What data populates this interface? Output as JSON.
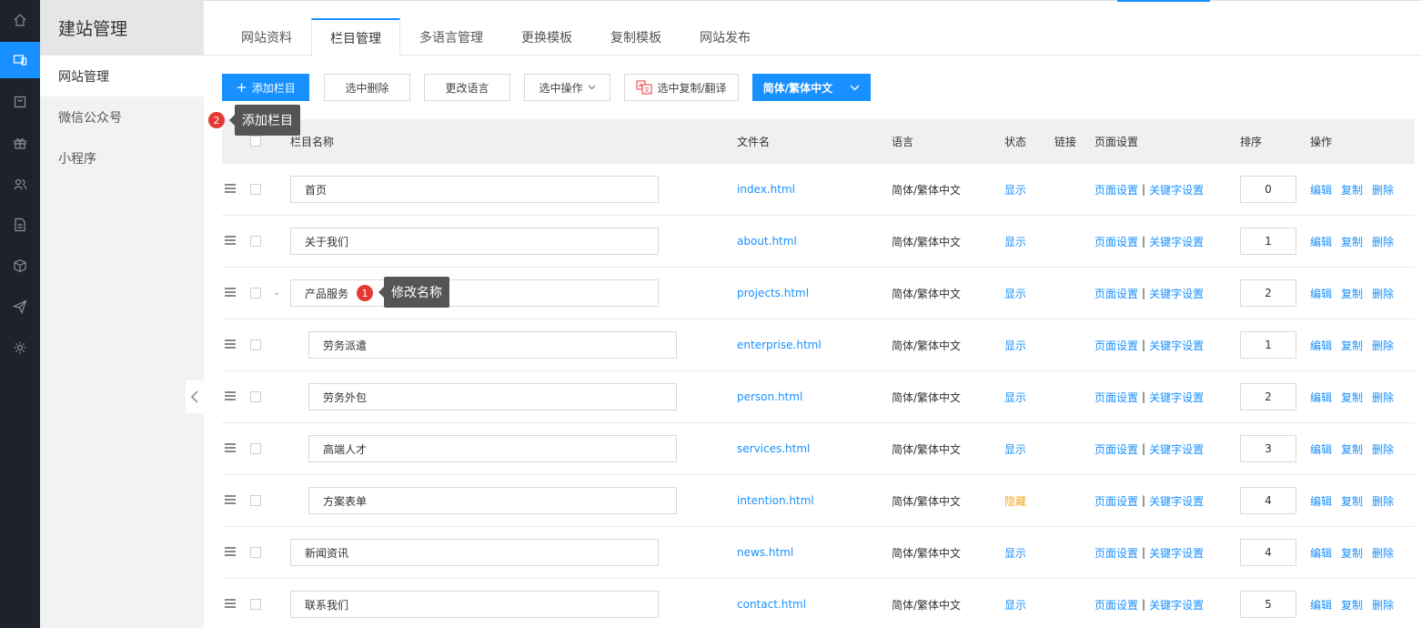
{
  "rail": {
    "items": [
      {
        "icon": "home-icon"
      },
      {
        "icon": "website-icon"
      },
      {
        "icon": "shop-icon"
      },
      {
        "icon": "gift-icon"
      },
      {
        "icon": "users-icon"
      },
      {
        "icon": "document-icon"
      },
      {
        "icon": "cube-icon"
      },
      {
        "icon": "send-icon"
      },
      {
        "icon": "settings-icon"
      }
    ],
    "active_index": 1
  },
  "sidebar": {
    "title": "建站管理",
    "items": [
      {
        "label": "网站管理"
      },
      {
        "label": "微信公众号"
      },
      {
        "label": "小程序"
      }
    ]
  },
  "tabs": [
    {
      "label": "网站资料"
    },
    {
      "label": "栏目管理"
    },
    {
      "label": "多语言管理"
    },
    {
      "label": "更换模板"
    },
    {
      "label": "复制模板"
    },
    {
      "label": "网站发布"
    }
  ],
  "toolbar": {
    "add_label": "添加栏目",
    "delete_selected_label": "选中删除",
    "change_language_label": "更改语言",
    "select_ops_label": "选中操作",
    "copy_translate_label": "选中复制/翻译",
    "language_select_label": "简体/繁体中文"
  },
  "table": {
    "headers": {
      "name": "栏目名称",
      "file": "文件名",
      "language": "语言",
      "status": "状态",
      "link": "链接",
      "page_settings": "页面设置",
      "sort": "排序",
      "actions": "操作"
    },
    "rows": [
      {
        "name": "首页",
        "file": "index.html",
        "language": "简体/繁体中文",
        "status": "显示",
        "page_setting": "页面设置",
        "keyword_setting": "关键字设置",
        "sort": "0",
        "edit": "编辑",
        "copy": "复制",
        "delete": "删除"
      },
      {
        "name": "关于我们",
        "file": "about.html",
        "language": "简体/繁体中文",
        "status": "显示",
        "page_setting": "页面设置",
        "keyword_setting": "关键字设置",
        "sort": "1",
        "edit": "编辑",
        "copy": "复制",
        "delete": "删除"
      },
      {
        "name": "产品服务",
        "file": "projects.html",
        "language": "简体/繁体中文",
        "status": "显示",
        "page_setting": "页面设置",
        "keyword_setting": "关键字设置",
        "sort": "2",
        "edit": "编辑",
        "copy": "复制",
        "delete": "删除"
      },
      {
        "name": "劳务派遣",
        "file": "enterprise.html",
        "language": "简体/繁体中文",
        "status": "显示",
        "page_setting": "页面设置",
        "keyword_setting": "关键字设置",
        "sort": "1",
        "edit": "编辑",
        "copy": "复制",
        "delete": "删除"
      },
      {
        "name": "劳务外包",
        "file": "person.html",
        "language": "简体/繁体中文",
        "status": "显示",
        "page_setting": "页面设置",
        "keyword_setting": "关键字设置",
        "sort": "2",
        "edit": "编辑",
        "copy": "复制",
        "delete": "删除"
      },
      {
        "name": "高端人才",
        "file": "services.html",
        "language": "简体/繁体中文",
        "status": "显示",
        "page_setting": "页面设置",
        "keyword_setting": "关键字设置",
        "sort": "3",
        "edit": "编辑",
        "copy": "复制",
        "delete": "删除"
      },
      {
        "name": "方案表单",
        "file": "intention.html",
        "language": "简体/繁体中文",
        "status": "隐藏",
        "page_setting": "页面设置",
        "keyword_setting": "关键字设置",
        "sort": "4",
        "edit": "编辑",
        "copy": "复制",
        "delete": "删除"
      },
      {
        "name": "新闻资讯",
        "file": "news.html",
        "language": "简体/繁体中文",
        "status": "显示",
        "page_setting": "页面设置",
        "keyword_setting": "关键字设置",
        "sort": "4",
        "edit": "编辑",
        "copy": "复制",
        "delete": "删除"
      },
      {
        "name": "联系我们",
        "file": "contact.html",
        "language": "简体/繁体中文",
        "status": "显示",
        "page_setting": "页面设置",
        "keyword_setting": "关键字设置",
        "sort": "5",
        "edit": "编辑",
        "copy": "复制",
        "delete": "删除"
      }
    ]
  },
  "tooltips": {
    "rename": {
      "badge": "1",
      "text": "修改名称"
    },
    "add": {
      "badge": "2",
      "text": "添加栏目"
    }
  },
  "colors": {
    "accent": "#1890ff",
    "rail_bg": "#1e222d",
    "hidden_status": "#f5a623",
    "badge": "#e53935"
  }
}
